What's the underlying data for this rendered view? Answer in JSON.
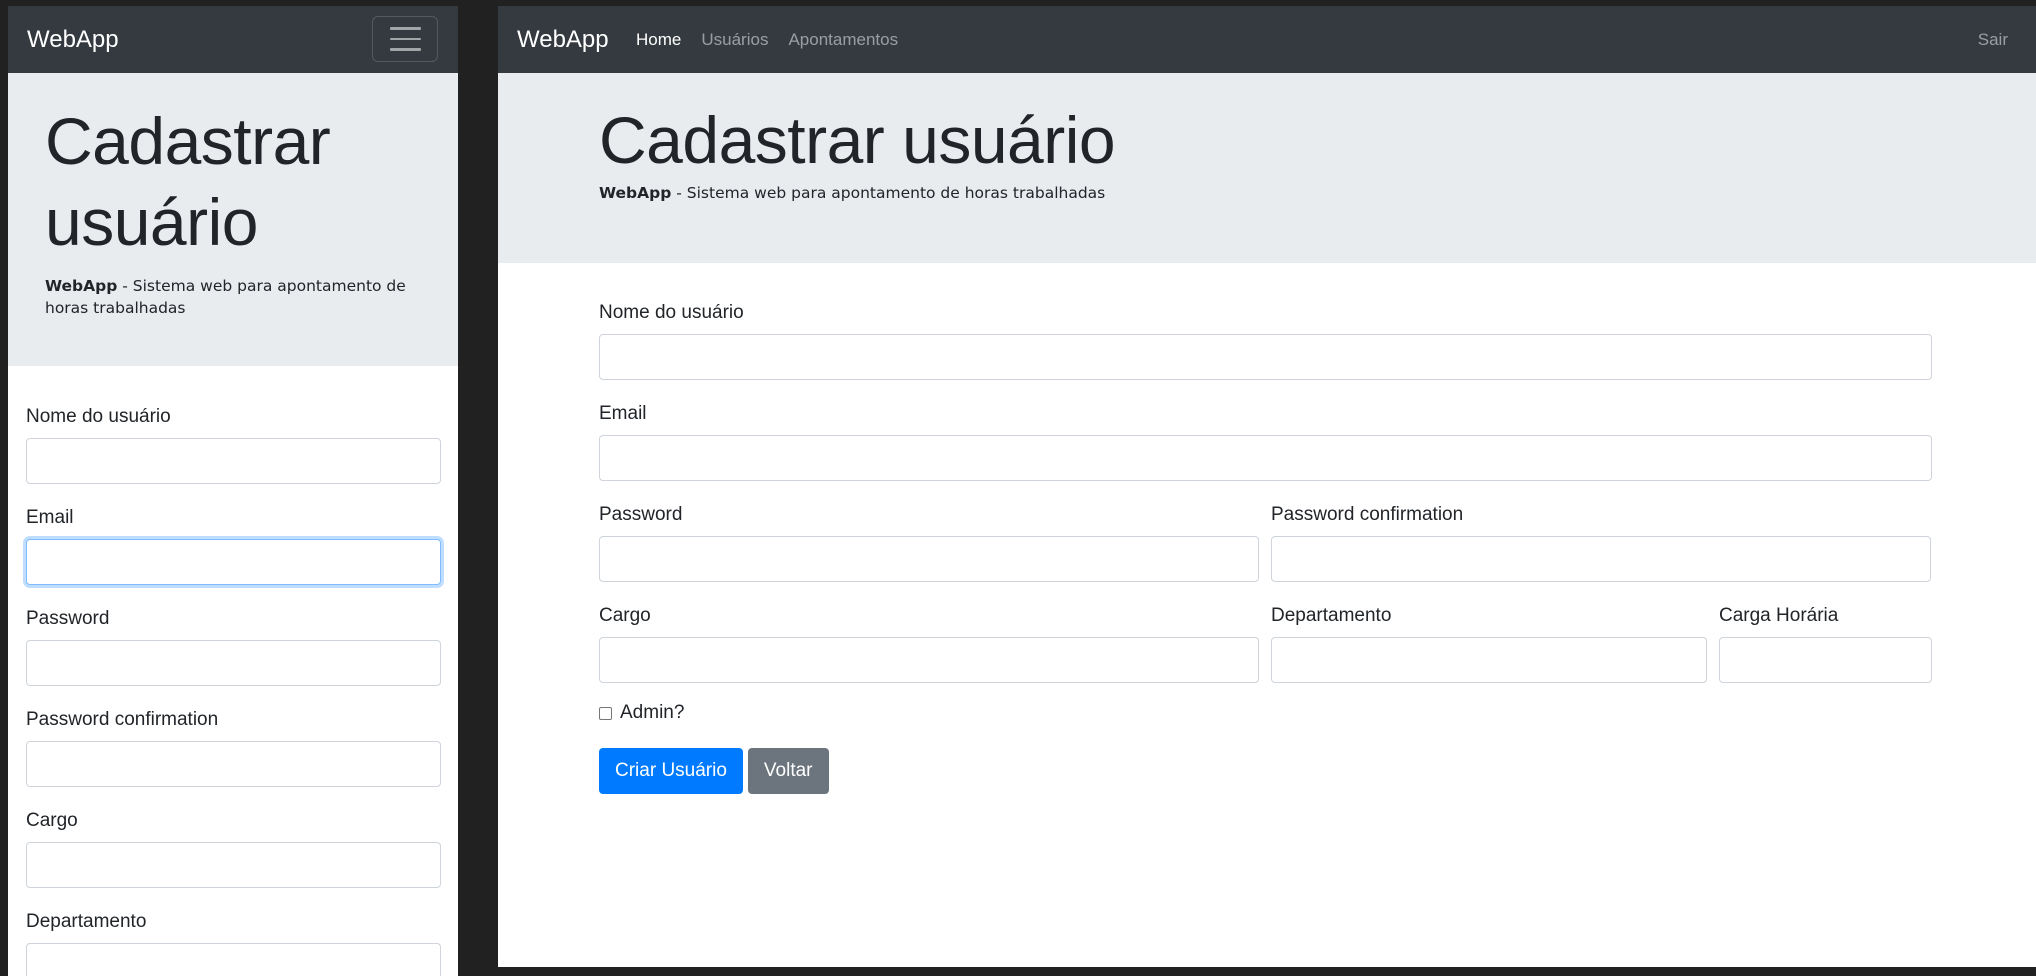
{
  "brand": "WebApp",
  "nav": {
    "items": [
      "Home",
      "Usuários",
      "Apontamentos"
    ],
    "logout": "Sair"
  },
  "jumbotron": {
    "title": "Cadastrar usuário",
    "lead_bold": "WebApp",
    "lead_text": " - Sistema web para apontamento de horas trabalhadas"
  },
  "form": {
    "name_label": "Nome do usuário",
    "email_label": "Email",
    "password_label": "Password",
    "password_confirmation_label": "Password confirmation",
    "cargo_label": "Cargo",
    "departamento_label": "Departamento",
    "carga_horaria_label": "Carga Horária",
    "admin_label": "Admin?",
    "admin_checked": false,
    "submit_label": "Criar Usuário",
    "back_label": "Voltar"
  },
  "colors": {
    "navbar": "#343a40",
    "jumbotron": "#e9ecef",
    "primary": "#007bff",
    "secondary": "#6c757d"
  }
}
